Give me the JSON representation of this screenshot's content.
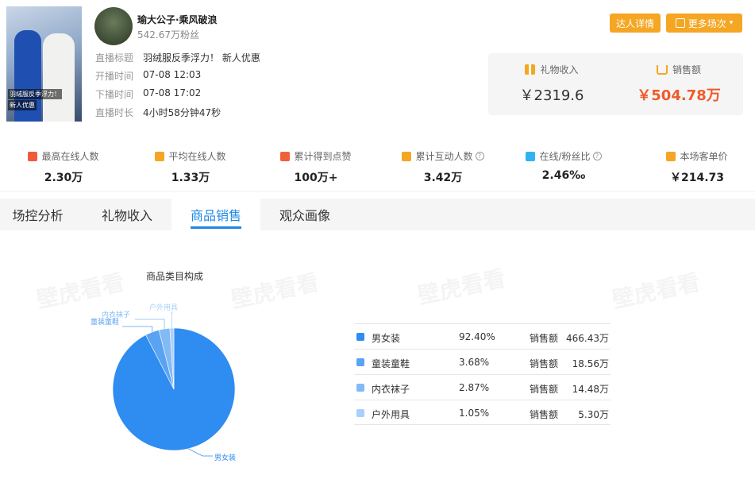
{
  "streamer": {
    "cover_caption_1": "羽绒服反季浮力！",
    "cover_caption_2": "新人优惠",
    "name": "瑜大公子·乘风破浪",
    "fans": "542.67万粉丝"
  },
  "live_info": [
    {
      "label": "直播标题",
      "value": "羽绒服反季浮力！  新人优惠"
    },
    {
      "label": "开播时间",
      "value": "07-08 12:03"
    },
    {
      "label": "下播时间",
      "value": "07-08 17:02"
    },
    {
      "label": "直播时长",
      "value": "4小时58分钟47秒"
    }
  ],
  "buttons": {
    "detail": "达人详情",
    "more": "更多场次"
  },
  "revenue": {
    "gift_label": "礼物收入",
    "gift_value": "￥2319.6",
    "sales_label": "销售额",
    "sales_value": "￥504.78万"
  },
  "stats": [
    {
      "label": "最高在线人数",
      "value": "2.30万",
      "icon": "arrow-up-icon",
      "color": "#f05a3a"
    },
    {
      "label": "平均在线人数",
      "value": "1.33万",
      "icon": "trend-icon",
      "color": "#f5a623"
    },
    {
      "label": "累计得到点赞",
      "value": "100万+",
      "icon": "heart-icon",
      "color": "#f0613a"
    },
    {
      "label": "累计互动人数",
      "value": "3.42万",
      "icon": "chat-icon",
      "color": "#f5a623",
      "help": "?"
    },
    {
      "label": "在线/粉丝比",
      "value": "2.46‰",
      "icon": "pie-icon",
      "color": "#30b3f0",
      "help": "?"
    },
    {
      "label": "本场客单价",
      "value": "￥214.73",
      "icon": "bag-icon",
      "color": "#f5a623"
    }
  ],
  "tabs": [
    "场控分析",
    "礼物收入",
    "商品销售",
    "观众画像"
  ],
  "watermark": "壁虎看看",
  "chart_data": {
    "type": "pie",
    "title": "商品类目构成",
    "slices": [
      {
        "name": "男女装",
        "percent": 92.4,
        "sales_label": "销售额",
        "sales": "466.43万",
        "color": "#2f8cf0"
      },
      {
        "name": "童装童鞋",
        "percent": 3.68,
        "sales_label": "销售额",
        "sales": "18.56万",
        "color": "#5aa3f3"
      },
      {
        "name": "内衣袜子",
        "percent": 2.87,
        "sales_label": "销售额",
        "sales": "14.48万",
        "color": "#82baf6"
      },
      {
        "name": "户外用具",
        "percent": 1.05,
        "sales_label": "销售额",
        "sales": "5.30万",
        "color": "#a9d0f9"
      }
    ],
    "percent_labels": [
      "92.40%",
      "3.68%",
      "2.87%",
      "1.05%"
    ]
  }
}
